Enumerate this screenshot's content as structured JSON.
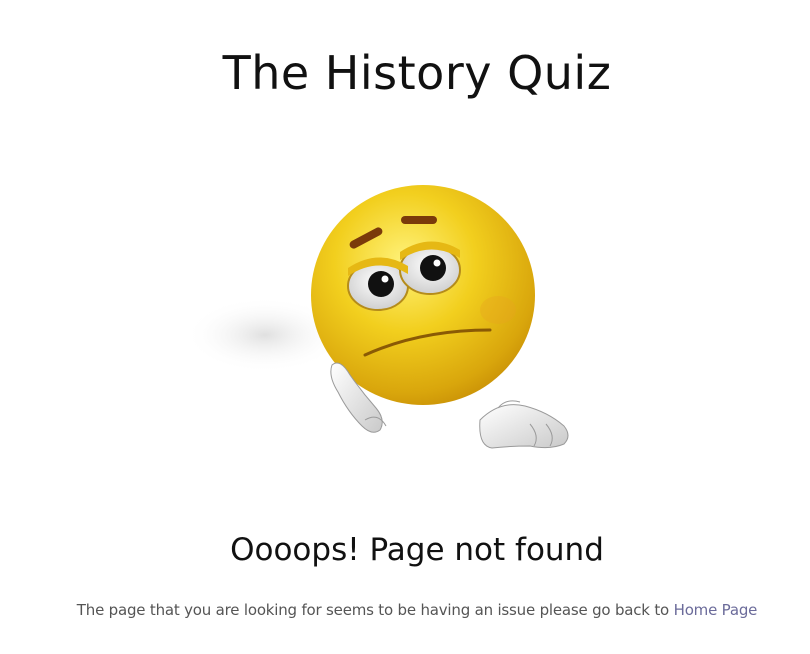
{
  "header": {
    "title": "The History Quiz"
  },
  "illustration": {
    "icon": "sad-emoji-icon",
    "face_color": "#f2c21a",
    "brow_color": "#7a3a0a"
  },
  "error": {
    "heading": "Oooops! Page not found",
    "message": "The page that you are looking for seems to be having an issue please go back to",
    "link_label": "Home Page",
    "link_color": "#6b6b9a"
  }
}
